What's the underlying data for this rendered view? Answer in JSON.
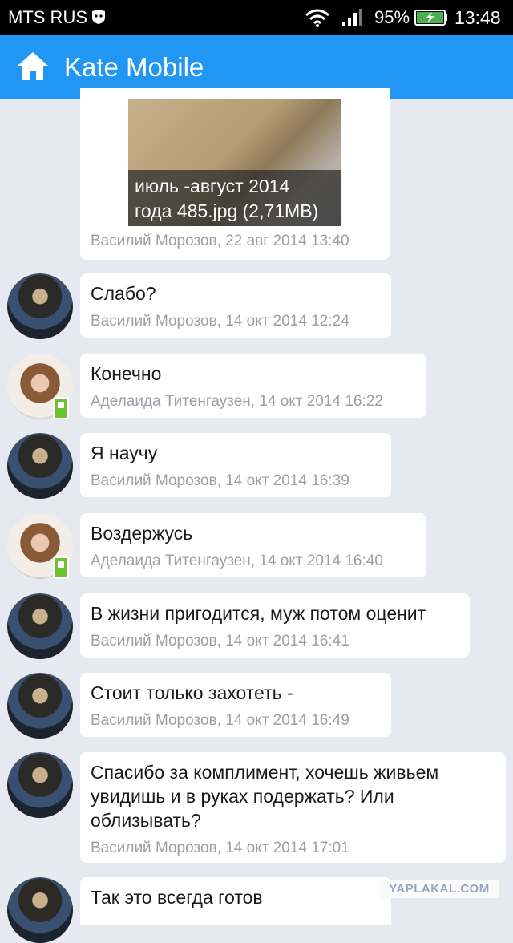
{
  "status_bar": {
    "carrier": "MTS RUS",
    "battery_percent": "95%",
    "time": "13:48"
  },
  "app_bar": {
    "title": "Kate Mobile"
  },
  "photo": {
    "caption_line1": "июль -август 2014",
    "caption_line2": "года 485.jpg (2,71MB)"
  },
  "messages": [
    {
      "text": "",
      "meta": "Василий Морозов, 22 авг 2014 13:40"
    },
    {
      "text": "Слабо?",
      "meta": "Василий Морозов, 14 окт 2014 12:24"
    },
    {
      "text": "Конечно",
      "meta": "Аделаида Титенгаузен, 14 окт 2014 16:22"
    },
    {
      "text": "Я научу",
      "meta": "Василий Морозов, 14 окт 2014 16:39"
    },
    {
      "text": "Воздержусь",
      "meta": "Аделаида Титенгаузен, 14 окт 2014 16:40"
    },
    {
      "text": "В жизни пригодится, муж потом оценит",
      "meta": "Василий Морозов, 14 окт 2014 16:41"
    },
    {
      "text": "Стоит только захотеть -",
      "meta": "Василий Морозов, 14 окт 2014 16:49"
    },
    {
      "text": "Спасибо за комплимент, хочешь живьем увидишь и в руках подержать? Или облизывать?",
      "meta": "Василий Морозов, 14 окт 2014 17:01"
    },
    {
      "text": "Так это всегда готов",
      "meta": ""
    }
  ],
  "watermark": "YAPLAKAL.COM"
}
